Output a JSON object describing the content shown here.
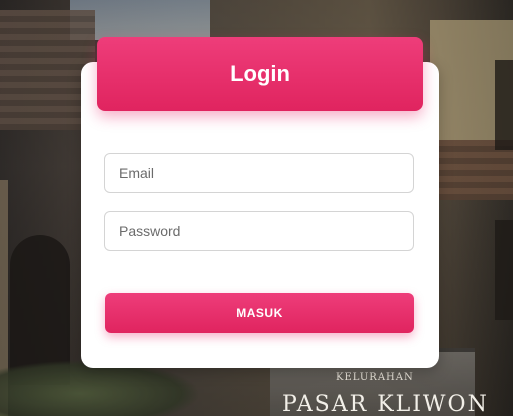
{
  "login": {
    "title": "Login",
    "email_placeholder": "Email",
    "password_placeholder": "Password",
    "submit_label": "MASUK"
  },
  "background": {
    "sign_small": "KELURAHAN",
    "sign_big": "PASAR KLIWON"
  },
  "colors": {
    "accent": "#e91e63",
    "card": "#ffffff"
  }
}
